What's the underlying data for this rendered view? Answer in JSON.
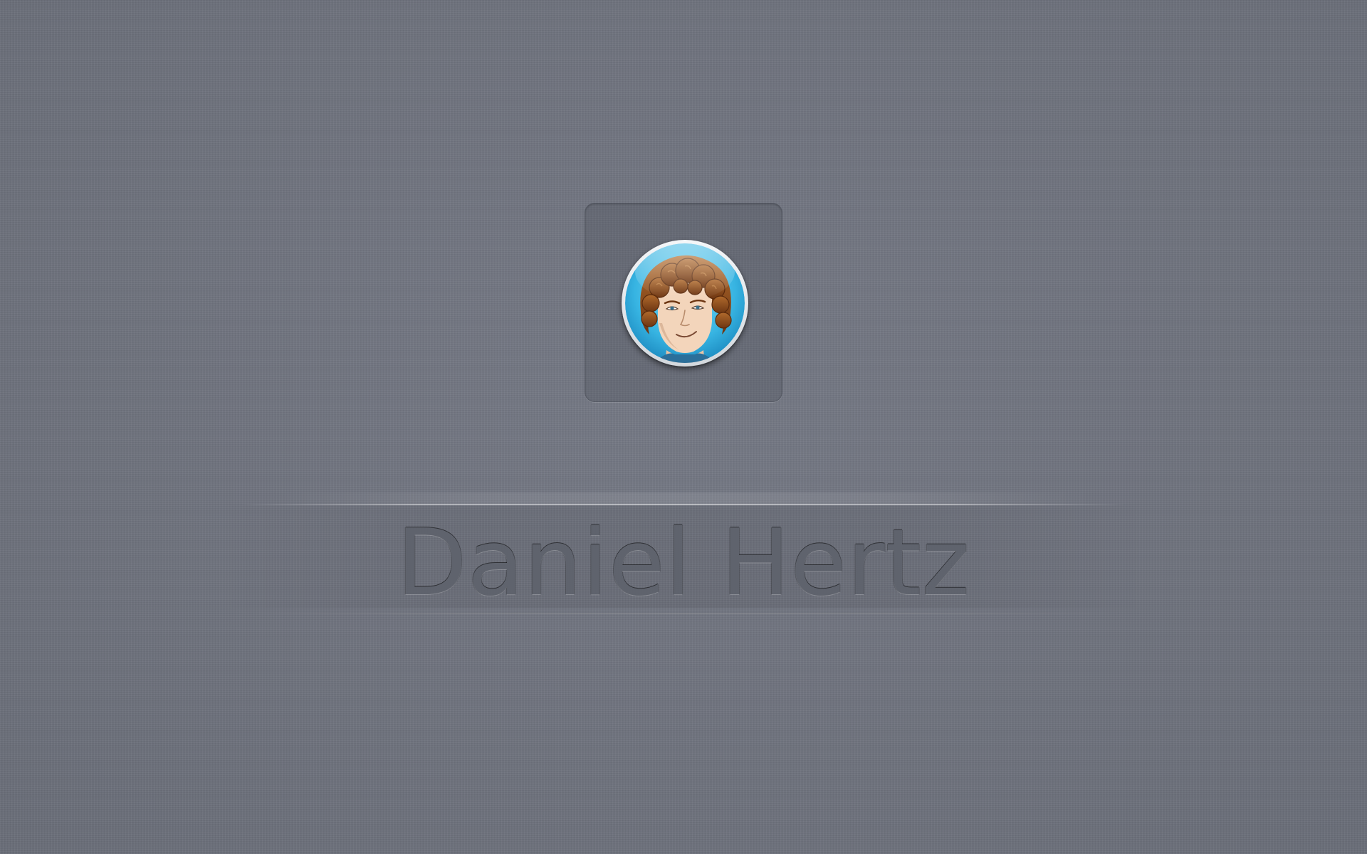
{
  "login": {
    "user_name": "Daniel Hertz",
    "avatar_icon": "user-avatar-cartoon-icon"
  },
  "colors": {
    "background": "#6e727d",
    "avatar_ring": "#2ea8d8",
    "hair": "#8a4a1c",
    "skin": "#f2d3b8"
  }
}
